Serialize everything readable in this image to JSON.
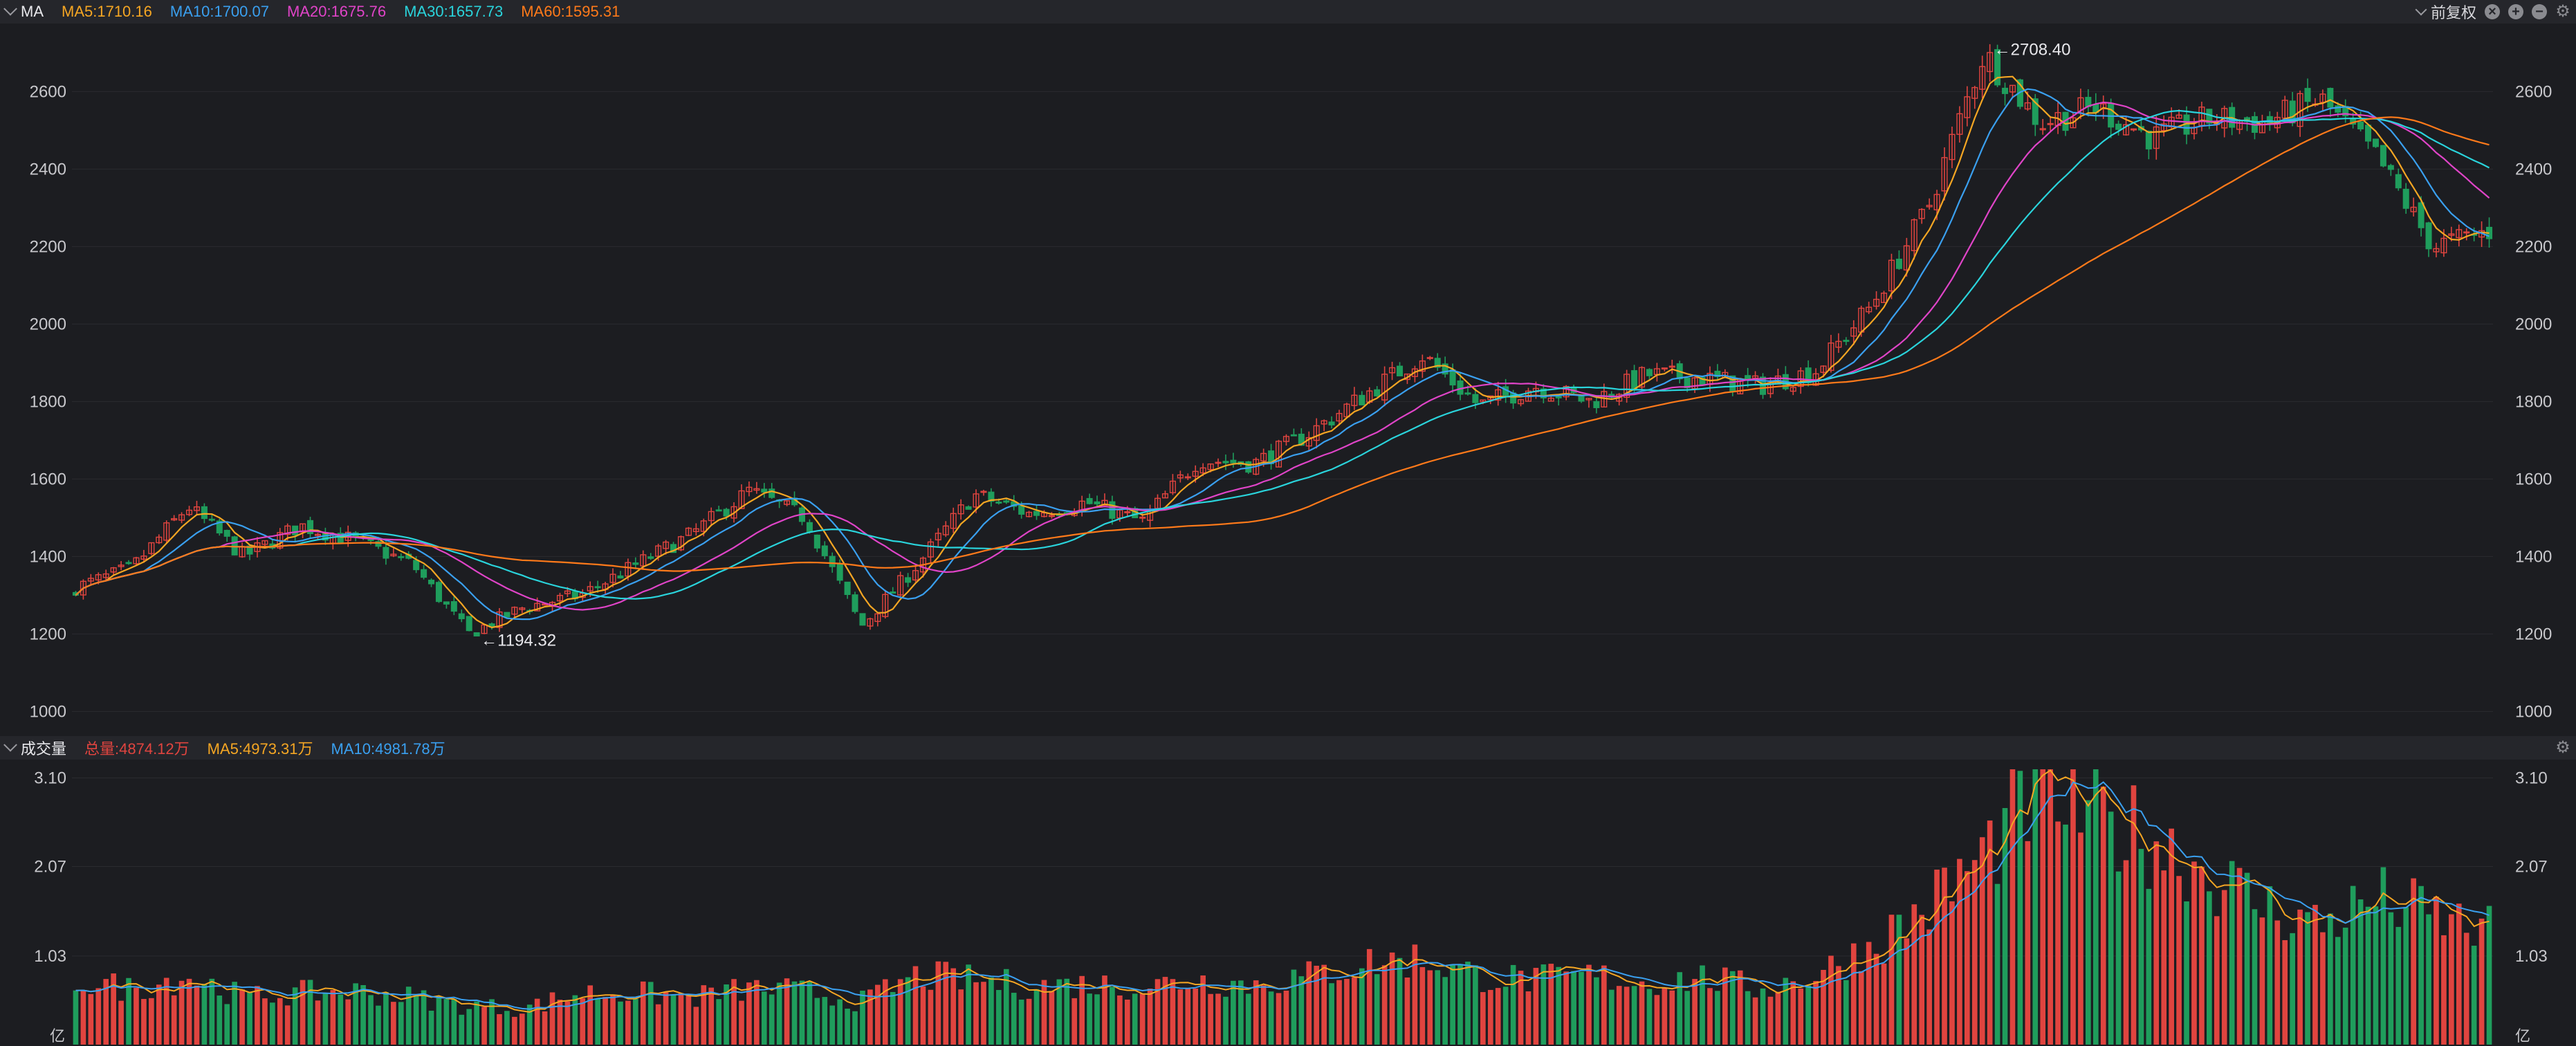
{
  "header": {
    "indicator_label": "MA",
    "ma5": "MA5:1710.16",
    "ma10": "MA10:1700.07",
    "ma20": "MA20:1675.76",
    "ma30": "MA30:1657.73",
    "ma60": "MA60:1595.31",
    "adjust_label": "前复权"
  },
  "volume_header": {
    "indicator_label": "成交量",
    "total": "总量:4874.12万",
    "ma5": "MA5:4973.31万",
    "ma10": "MA10:4981.78万"
  },
  "colors": {
    "up": "#e0443f",
    "down": "#1f9d5c",
    "ma5": "#f5a623",
    "ma10": "#3aa0f0",
    "ma20": "#e044c8",
    "ma30": "#2ad4dc",
    "ma60": "#ff7a1a",
    "grid": "#2a2b30",
    "background": "#1c1d21"
  },
  "chart_data": [
    {
      "type": "candlestick",
      "yticks": [
        1000,
        1200,
        1400,
        1600,
        1800,
        2000,
        2200,
        2400,
        2600
      ],
      "ylim": [
        990,
        2740
      ],
      "annotations": [
        {
          "text": "←2708.40",
          "value": 2708.4
        },
        {
          "text": "←1194.32",
          "value": 1194.32
        }
      ],
      "series_close_anchors": [
        1320,
        1370,
        1530,
        1400,
        1480,
        1440,
        1380,
        1200,
        1270,
        1300,
        1380,
        1460,
        1570,
        1500,
        1220,
        1380,
        1560,
        1510,
        1540,
        1490,
        1650,
        1640,
        1720,
        1820,
        1920,
        1790,
        1840,
        1800,
        1870,
        1860,
        1840,
        1880,
        2050,
        2300,
        2700,
        2520,
        2560,
        2480,
        2530,
        2520,
        2580,
        2430,
        2200,
        2240
      ],
      "candle_count": 320
    },
    {
      "type": "bar",
      "yticks": [
        "1.03",
        "2.07",
        "3.10"
      ],
      "y_unit": "亿",
      "ylim": [
        0,
        3.2
      ],
      "values_anchor": [
        0.75,
        0.65,
        0.8,
        0.55,
        0.6,
        0.62,
        0.55,
        0.45,
        0.42,
        0.6,
        0.6,
        0.55,
        0.65,
        0.62,
        0.5,
        0.8,
        0.75,
        0.68,
        0.7,
        0.68,
        0.75,
        0.7,
        0.8,
        0.95,
        1.0,
        0.8,
        0.75,
        0.8,
        0.72,
        0.78,
        0.65,
        0.8,
        1.15,
        1.6,
        2.2,
        3.0,
        2.6,
        2.4,
        2.0,
        1.6,
        1.4,
        1.7,
        1.5,
        1.3
      ],
      "bar_count": 320
    }
  ]
}
